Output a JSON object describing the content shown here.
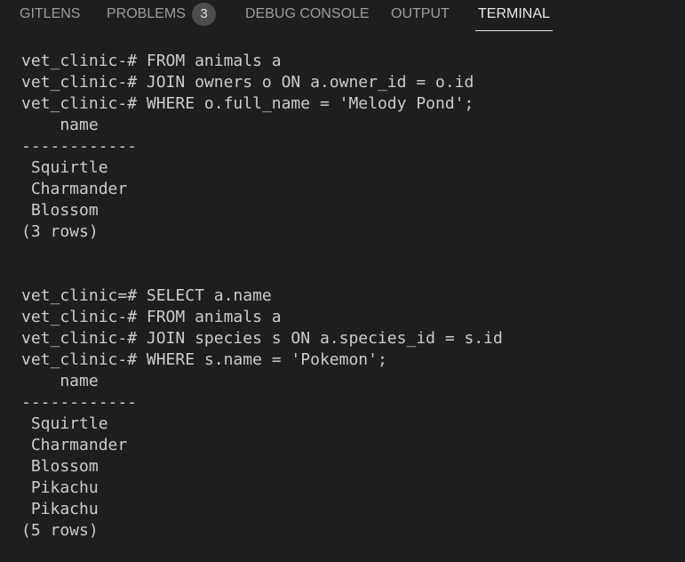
{
  "panel": {
    "tabs": [
      {
        "label": "GITLENS",
        "active": false
      },
      {
        "label": "PROBLEMS",
        "active": false,
        "badge": "3"
      },
      {
        "label": "DEBUG CONSOLE",
        "active": false
      },
      {
        "label": "OUTPUT",
        "active": false
      },
      {
        "label": "TERMINAL",
        "active": true
      }
    ]
  },
  "colors": {
    "background": "#1e1e1e",
    "text": "#cccccc",
    "tab_inactive": "#9d9d9d",
    "tab_active": "#e7e7e7",
    "badge_bg": "#4d4d4d"
  },
  "terminal": {
    "lines": [
      "vet_clinic-# FROM animals a",
      "vet_clinic-# JOIN owners o ON a.owner_id = o.id",
      "vet_clinic-# WHERE o.full_name = 'Melody Pond';",
      "    name",
      "------------",
      " Squirtle",
      " Charmander",
      " Blossom",
      "(3 rows)",
      "",
      "",
      "vet_clinic=# SELECT a.name",
      "vet_clinic-# FROM animals a",
      "vet_clinic-# JOIN species s ON a.species_id = s.id",
      "vet_clinic-# WHERE s.name = 'Pokemon';",
      "    name",
      "------------",
      " Squirtle",
      " Charmander",
      " Blossom",
      " Pikachu",
      " Pikachu",
      "(5 rows)"
    ]
  }
}
